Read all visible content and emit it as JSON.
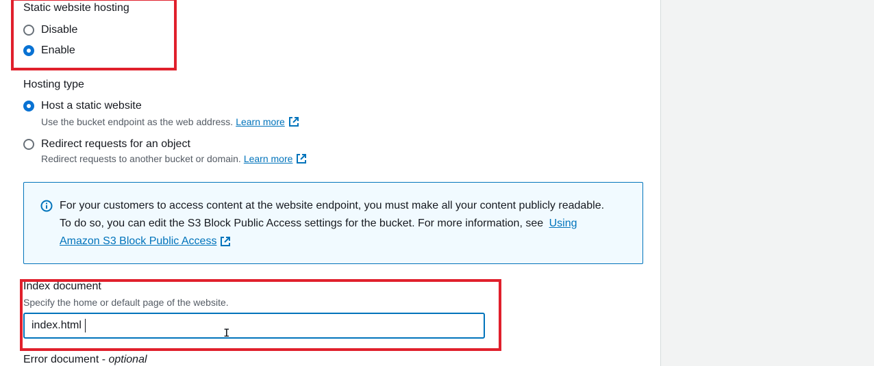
{
  "static_hosting": {
    "label": "Static website hosting",
    "options": [
      {
        "label": "Disable",
        "checked": false
      },
      {
        "label": "Enable",
        "checked": true
      }
    ]
  },
  "hosting_type": {
    "label": "Hosting type",
    "options": [
      {
        "label": "Host a static website",
        "description": "Use the bucket endpoint as the web address.",
        "link": "Learn more",
        "checked": true
      },
      {
        "label": "Redirect requests for an object",
        "description": "Redirect requests to another bucket or domain.",
        "link": "Learn more",
        "checked": false
      }
    ]
  },
  "info": {
    "text": "For your customers to access content at the website endpoint, you must make all your content publicly readable. To do so, you can edit the S3 Block Public Access settings for the bucket. For more information, see",
    "link": "Using Amazon S3 Block Public Access"
  },
  "index_document": {
    "label": "Index document",
    "hint": "Specify the home or default page of the website.",
    "value": "index.html"
  },
  "error_document": {
    "label": "Error document - ",
    "optional": "optional"
  },
  "colors": {
    "accent": "#0073bb",
    "highlight": "#e0202c",
    "info_bg": "#f1faff"
  }
}
